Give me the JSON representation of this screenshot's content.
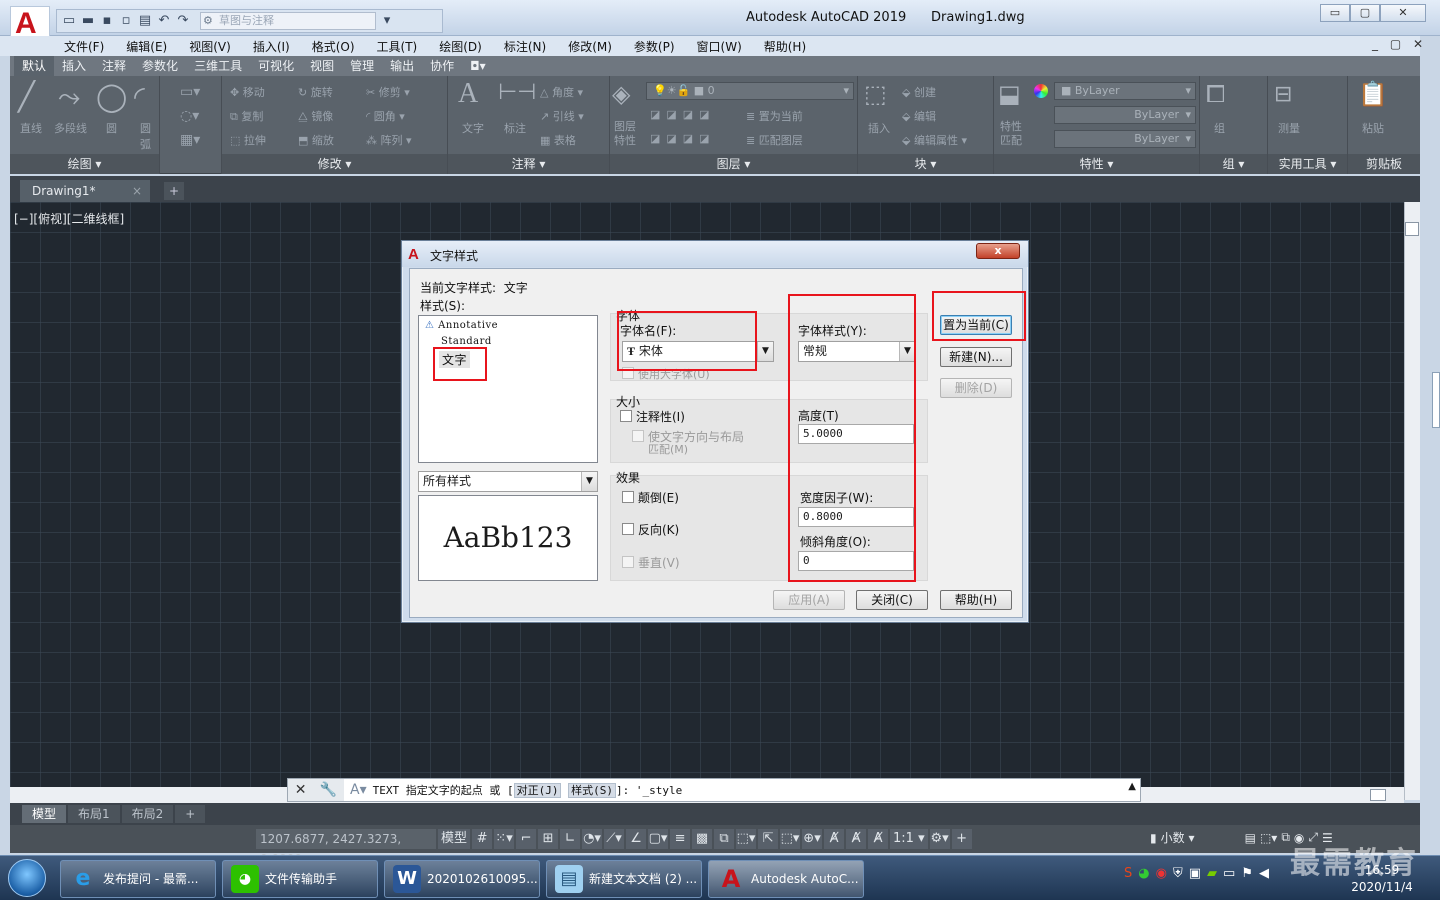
{
  "app": {
    "logo_letter": "A",
    "workspace": "草图与注释",
    "title": "Autodesk AutoCAD 2019",
    "filename": "Drawing1.dwg",
    "window_buttons": [
      "▭",
      "▢",
      "✕"
    ]
  },
  "menu": [
    "文件(F)",
    "编辑(E)",
    "视图(V)",
    "插入(I)",
    "格式(O)",
    "工具(T)",
    "绘图(D)",
    "标注(N)",
    "修改(M)",
    "参数(P)",
    "窗口(W)",
    "帮助(H)"
  ],
  "ribbon_tabs": [
    "默认",
    "插入",
    "注释",
    "参数化",
    "三维工具",
    "可视化",
    "视图",
    "管理",
    "输出",
    "协作"
  ],
  "ribbon": {
    "draw": {
      "title": "绘图 ▾",
      "tools": [
        "直线",
        "多段线",
        "圆",
        "圆弧"
      ]
    },
    "modify": {
      "title": "修改 ▾",
      "tools": [
        "移动",
        "旋转",
        "修剪 ▾",
        "复制",
        "镜像",
        "圆角 ▾",
        "拉伸",
        "缩放",
        "阵列 ▾"
      ]
    },
    "annotation": {
      "title": "注释 ▾",
      "tools": [
        "文字",
        "标注",
        "角度 ▾",
        "引线 ▾",
        "表格"
      ]
    },
    "layers": {
      "title": "图层 ▾",
      "layer_value": "0",
      "tools": [
        "图层特性",
        "置为当前",
        "匹配图层"
      ]
    },
    "block": {
      "title": "块 ▾",
      "tools": [
        "插入",
        "创建",
        "编辑",
        "编辑属性 ▾"
      ]
    },
    "properties": {
      "title": "特性 ▾",
      "tools": [
        "特性匹配"
      ],
      "bylayer": [
        "ByLayer",
        "ByLayer",
        "ByLayer"
      ]
    },
    "groups": {
      "title": "组 ▾",
      "tools": [
        "组"
      ]
    },
    "utilities": {
      "title": "实用工具 ▾",
      "tools": [
        "测量"
      ]
    },
    "clipboard": {
      "title": "剪贴板",
      "tools": [
        "粘贴"
      ]
    }
  },
  "doc_tab": {
    "name": "Drawing1*",
    "close": "×",
    "plus": "+"
  },
  "viewport_label": "[−][俯视][二维线框]",
  "dialog": {
    "title": "文字样式",
    "close": "x",
    "current_style_label": "当前文字样式:",
    "current_style_value": "文字",
    "styles_label": "样式(S):",
    "styles": [
      "Annotative",
      "Standard",
      "文字"
    ],
    "filter": "所有样式",
    "preview_text": "AaBb123",
    "font_group": "字体",
    "font_name_label": "字体名(F):",
    "font_name_value": "宋体",
    "font_style_label": "字体样式(Y):",
    "font_style_value": "常规",
    "use_bigfont": "使用大字体(U)",
    "size_group": "大小",
    "annotative": "注释性(I)",
    "match_orient_1": "使文字方向与布局",
    "match_orient_2": "匹配(M)",
    "height_label": "高度(T)",
    "height_value": "5.0000",
    "effects_group": "效果",
    "upside_down": "颠倒(E)",
    "backwards": "反向(K)",
    "vertical": "垂直(V)",
    "width_label": "宽度因子(W):",
    "width_value": "0.8000",
    "oblique_label": "倾斜角度(O):",
    "oblique_value": "0",
    "btn_set_current": "置为当前(C)",
    "btn_new": "新建(N)...",
    "btn_delete": "删除(D)",
    "btn_apply": "应用(A)",
    "btn_close": "关闭(C)",
    "btn_help": "帮助(H)"
  },
  "command": {
    "cmd": "TEXT",
    "prompt": "指定文字的起点 或 [",
    "opt1": "对正(J)",
    "opt2": "样式(S)",
    "tail": "]: '_style"
  },
  "layout_tabs": [
    "模型",
    "布局1",
    "布局2",
    "+"
  ],
  "status": {
    "coords": "1207.6877, 2427.3273, 0.0000",
    "model": "模型",
    "scale": "1:1 ▾",
    "units": "小数"
  },
  "taskbar": {
    "items": [
      "发布提问 - 最需...",
      "文件传输助手",
      "2020102610095...",
      "新建文本文档 (2) ...",
      "Autodesk AutoC..."
    ],
    "time": "16:59",
    "date": "2020/11/4",
    "watermark": "最需教育"
  },
  "colors": {
    "autocad_red": "#c8131b",
    "highlight_red": "#e8141c",
    "canvas": "#212830",
    "ribbon": "#5b636b"
  }
}
